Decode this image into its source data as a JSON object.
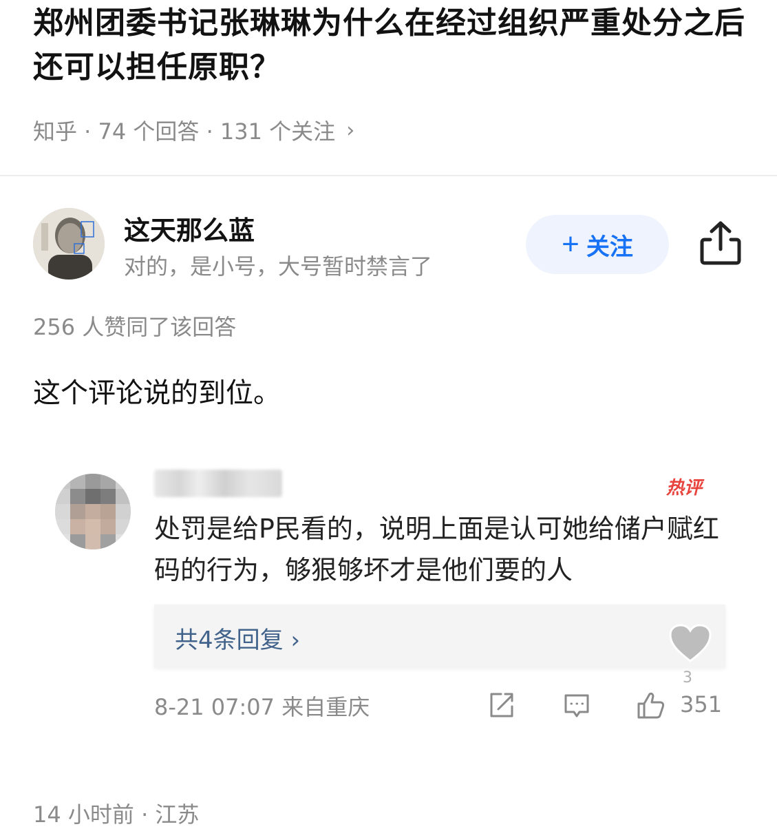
{
  "question": {
    "title": "郑州团委书记张琳琳为什么在经过组织严重处分之后还可以担任原职？",
    "meta": "知乎 · 74 个回答 · 131 个关注",
    "chevron": "›"
  },
  "answer": {
    "author_name": "这天那么蓝",
    "author_bio": "对的，是小号，大号暂时禁言了",
    "follow_label": "关注",
    "follow_plus": "+",
    "voters": "256 人赞同了该回答",
    "text": "这个评论说的到位。",
    "footer": "14 小时前 · 江苏"
  },
  "embedded_comment": {
    "badge": "热评",
    "text": "处罚是给P民看的，说明上面是认可她给储户赋红码的行为，够狠够坏才是他们要的人",
    "replies_label": "共4条回复 ›",
    "heart_count": "3",
    "meta": "8-21 07:07  来自重庆",
    "like_count": "351"
  },
  "colors": {
    "accent": "#1772f6",
    "follow_bg": "#eef3fd",
    "muted": "#8a8a8a",
    "hot": "#e8433c",
    "reply_link": "#41628a"
  },
  "icons": [
    "share-icon",
    "external-link-icon",
    "comment-icon",
    "thumbs-up-icon",
    "heart-icon",
    "chevron-right-icon",
    "plus-icon"
  ]
}
